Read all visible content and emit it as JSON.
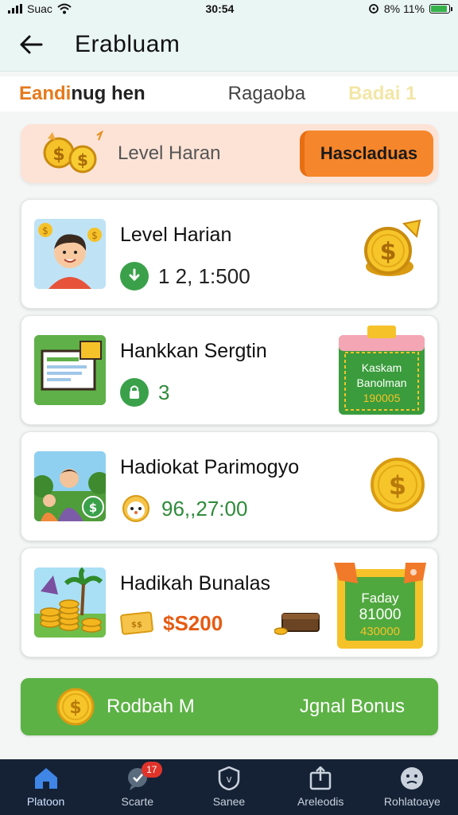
{
  "status_bar": {
    "carrier": "Suac",
    "time": "30:54",
    "battery": "8% 11%"
  },
  "header": {
    "title": "Erabluam"
  },
  "tabs": [
    {
      "label_a": "Eandi",
      "label_b": "nug hen"
    },
    {
      "label": "Ragaoba"
    },
    {
      "label": "Badai 1"
    }
  ],
  "banner": {
    "label": "Level Haran",
    "button": "Hascladuas"
  },
  "cards": [
    {
      "title": "Level Harian",
      "value": "1 2, 1:500",
      "value_color": "#222"
    },
    {
      "title": "Hankkan Sergtin",
      "value": "3",
      "value_color": "#2e8b3a",
      "voucher": {
        "line1": "Kaskam",
        "line2": "Banolman",
        "line3": "190005"
      }
    },
    {
      "title": "Hadiokat Parimogyo",
      "value": "96,,27:00",
      "value_color": "#2e8b3a"
    },
    {
      "title": "Hadikah Bunalas",
      "value": "$S200",
      "value_color": "#e65b12",
      "voucher": {
        "line1": "Faday",
        "line2": "81000",
        "line3": "430000"
      }
    }
  ],
  "bonus": {
    "left": "Rodbah M",
    "right": "Jgnal Bonus"
  },
  "nav": [
    {
      "label": "Platoon"
    },
    {
      "label": "Scarte",
      "badge": "17"
    },
    {
      "label": "Sanee"
    },
    {
      "label": "Areleodis"
    },
    {
      "label": "Rohlatoaye"
    }
  ]
}
